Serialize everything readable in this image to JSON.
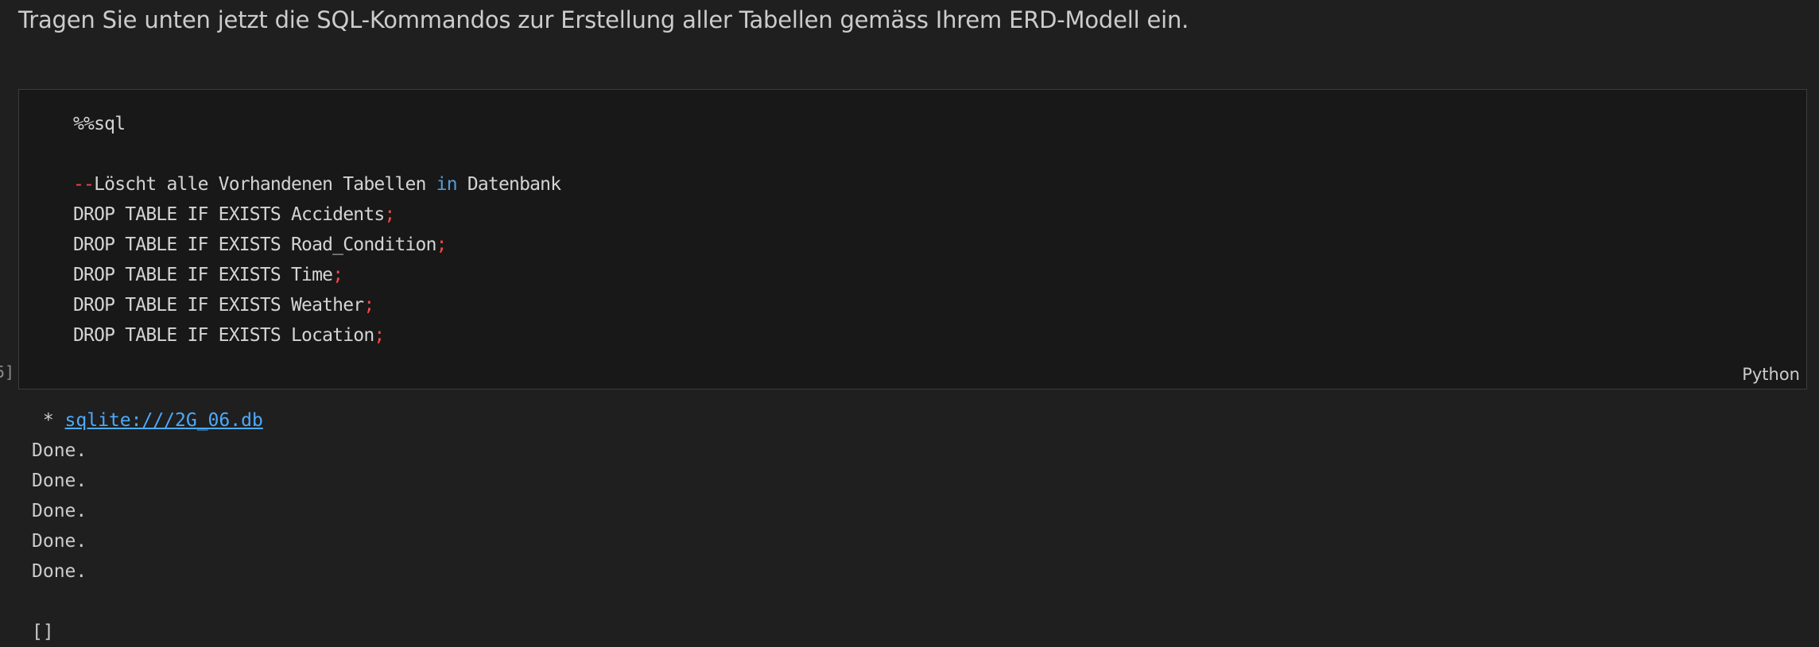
{
  "markdown": {
    "text": "Tragen Sie unten jetzt die SQL-Kommandos zur Erstellung aller Tabellen gemäss Ihrem ERD-Modell ein."
  },
  "cell": {
    "execution_count": "5]",
    "language": "Python",
    "code": {
      "magic": "%%sql",
      "comment_prefix": "--",
      "comment_a": "Löscht alle Vorhandenen Tabellen ",
      "comment_kw": "in",
      "comment_b": " Datenbank",
      "statements": [
        "DROP TABLE IF EXISTS Accidents",
        "DROP TABLE IF EXISTS Road_Condition",
        "DROP TABLE IF EXISTS Time",
        "DROP TABLE IF EXISTS Weather",
        "DROP TABLE IF EXISTS Location"
      ],
      "terminator": ";"
    }
  },
  "output": {
    "prefix": " * ",
    "connection_link": "sqlite:///2G_06.db",
    "lines": [
      "Done.",
      "Done.",
      "Done.",
      "Done.",
      "Done."
    ],
    "result": "[]"
  }
}
